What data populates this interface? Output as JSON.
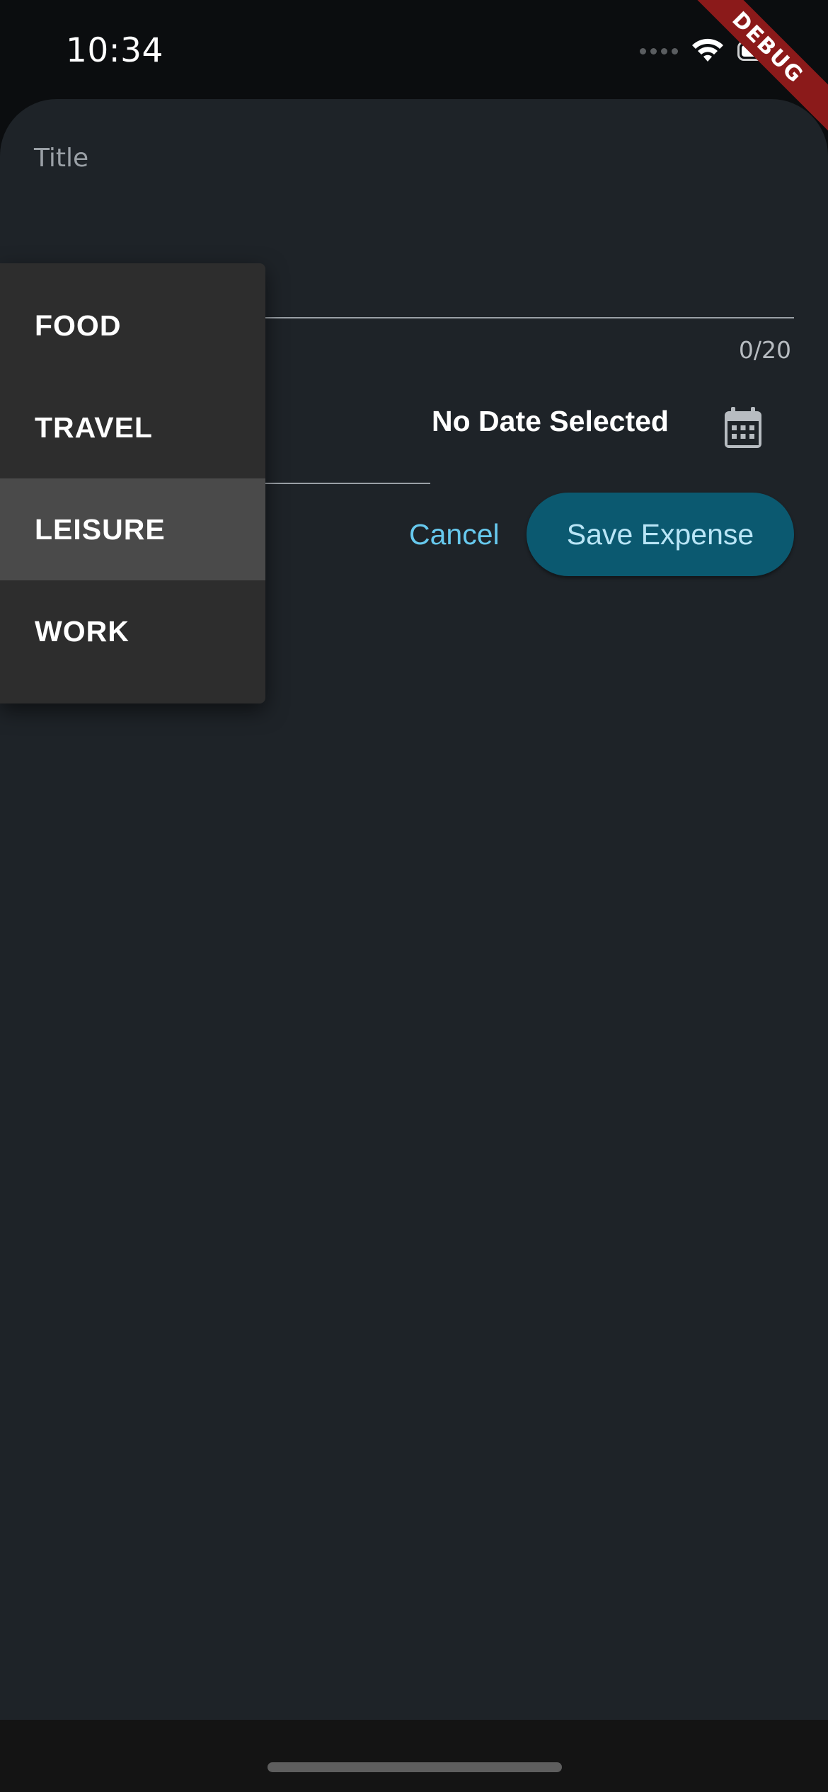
{
  "status_bar": {
    "time": "10:34",
    "icons": [
      "cellular-signal-icon",
      "wifi-icon",
      "battery-icon"
    ]
  },
  "debug_banner": "DEBUG",
  "form": {
    "title_label": "Title",
    "title_counter": "0/20",
    "date_text": "No Date Selected",
    "calendar_icon": "calendar-icon",
    "cancel_label": "Cancel",
    "save_label": "Save Expense"
  },
  "category_menu": {
    "items": [
      {
        "label": "FOOD"
      },
      {
        "label": "TRAVEL"
      },
      {
        "label": "LEISURE",
        "highlighted": true
      },
      {
        "label": "WORK"
      }
    ]
  },
  "colors": {
    "background": "#1e2328",
    "accent_text": "#67c9ee",
    "save_button": "#0b5970",
    "menu_background": "#2d2d2d",
    "menu_highlight": "#4a4a4a",
    "debug_ribbon": "#8b1a1a"
  }
}
